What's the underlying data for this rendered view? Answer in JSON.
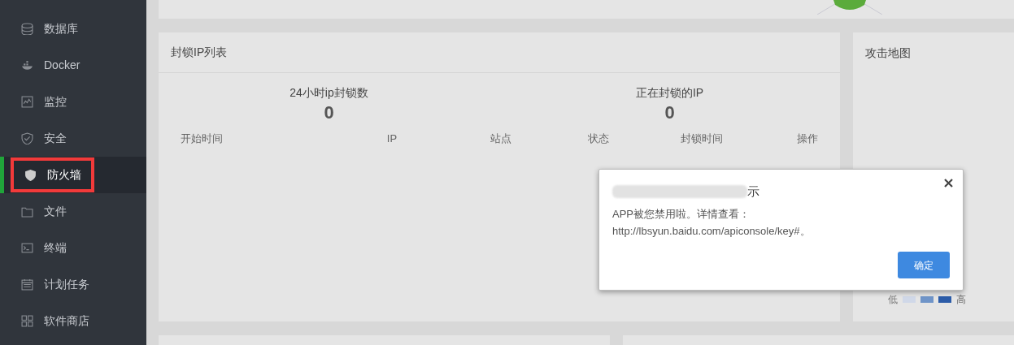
{
  "sidebar": {
    "items": [
      {
        "label": "数据库",
        "selected": false,
        "annotated": false
      },
      {
        "label": "Docker",
        "selected": false,
        "annotated": false
      },
      {
        "label": "监控",
        "selected": false,
        "annotated": false
      },
      {
        "label": "安全",
        "selected": false,
        "annotated": false
      },
      {
        "label": "防火墙",
        "selected": true,
        "annotated": true
      },
      {
        "label": "文件",
        "selected": false,
        "annotated": false
      },
      {
        "label": "终端",
        "selected": false,
        "annotated": false
      },
      {
        "label": "计划任务",
        "selected": false,
        "annotated": false
      },
      {
        "label": "软件商店",
        "selected": false,
        "annotated": false
      }
    ]
  },
  "blocked_ip_panel": {
    "title": "封锁IP列表",
    "stats": [
      {
        "label": "24小时ip封锁数",
        "value": "0"
      },
      {
        "label": "正在封锁的IP",
        "value": "0"
      }
    ],
    "table": {
      "columns": [
        "开始时间",
        "IP",
        "站点",
        "状态",
        "封锁时间",
        "操作"
      ]
    }
  },
  "attack_map_panel": {
    "title": "攻击地图",
    "legend": {
      "low": "低",
      "high": "高"
    }
  },
  "dialog": {
    "title": "示",
    "message": "APP被您禁用啦。详情查看：http://lbsyun.baidu.com/apiconsole/key#。",
    "button": "确定"
  }
}
